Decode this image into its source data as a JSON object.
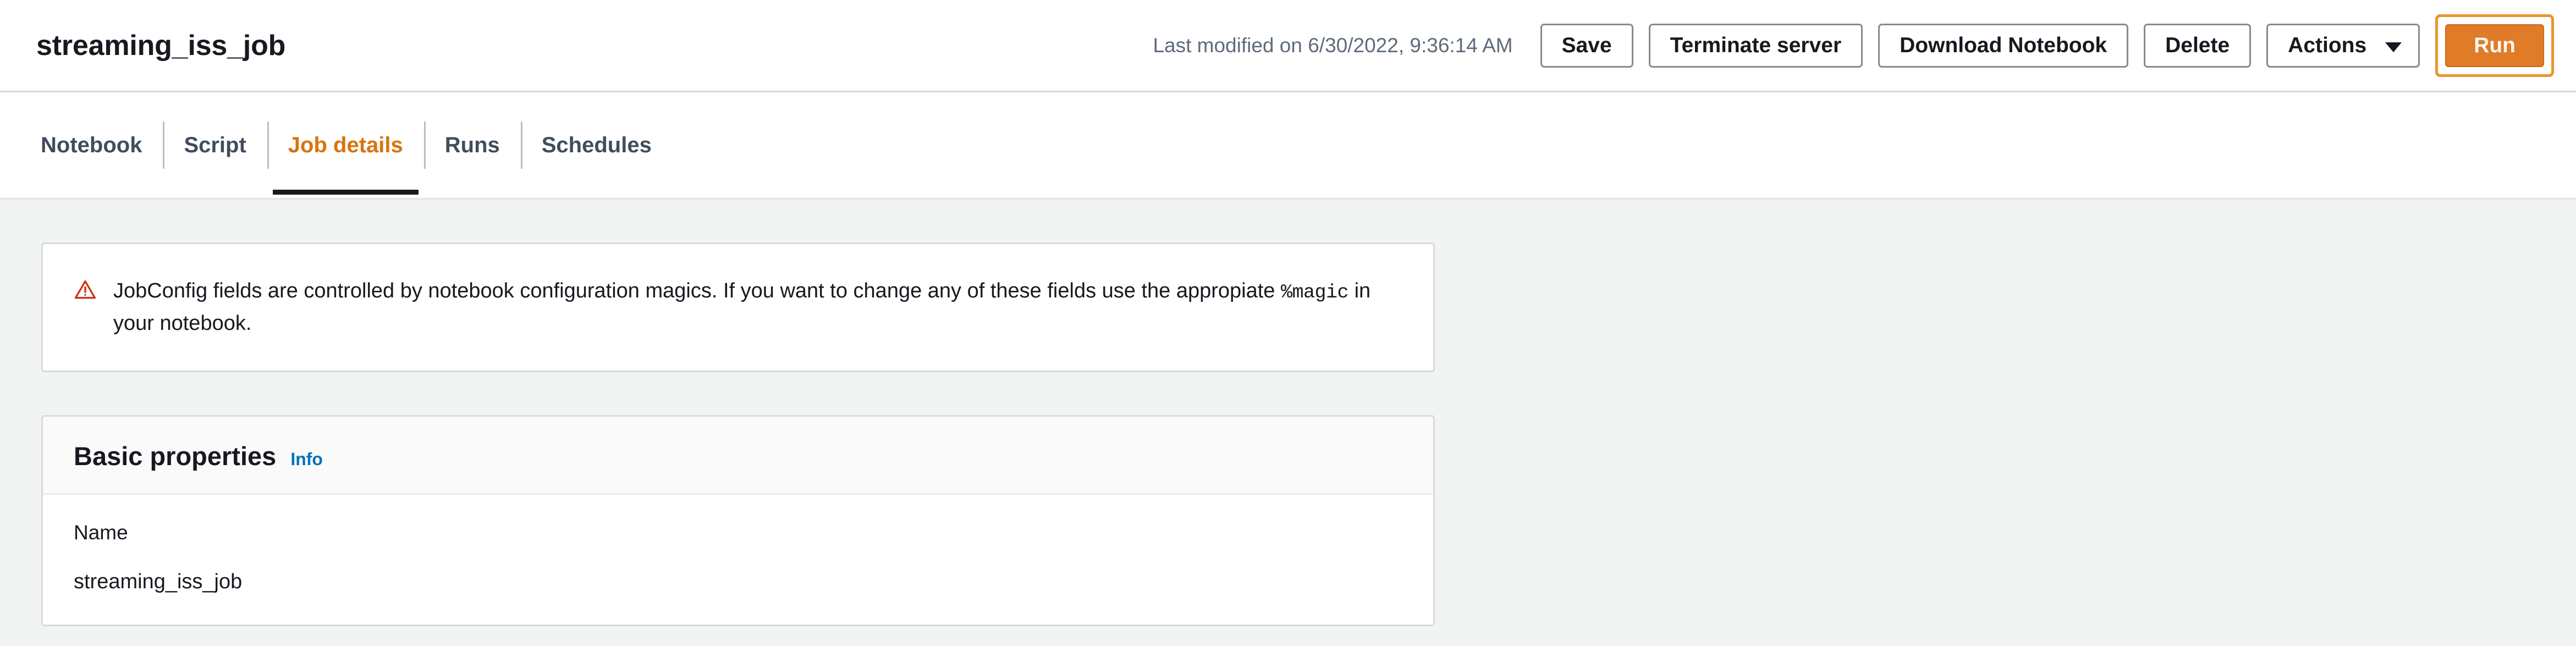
{
  "header": {
    "title": "streaming_iss_job",
    "last_modified": "Last modified on 6/30/2022, 9:36:14 AM",
    "buttons": {
      "save": "Save",
      "terminate_server": "Terminate server",
      "download_notebook": "Download Notebook",
      "delete": "Delete",
      "actions": "Actions",
      "run": "Run"
    }
  },
  "tabs": [
    {
      "label": "Notebook",
      "active": false
    },
    {
      "label": "Script",
      "active": false
    },
    {
      "label": "Job details",
      "active": true
    },
    {
      "label": "Runs",
      "active": false
    },
    {
      "label": "Schedules",
      "active": false
    }
  ],
  "alert": {
    "icon": "warning-triangle-icon",
    "text_before": "JobConfig fields are controlled by notebook configuration magics. If you want to change any of these fields use the appropiate ",
    "code": "%magic",
    "text_after": " in your notebook."
  },
  "basic_properties": {
    "title": "Basic properties",
    "info_link": "Info",
    "name_label": "Name",
    "name_value": "streaming_iss_job"
  },
  "colors": {
    "accent_orange": "#e07b28",
    "focus_ring_orange": "#e9962e",
    "active_tab_orange": "#d9730d",
    "link_blue": "#0073bb",
    "warning_red": "#d13212",
    "content_bg": "#f2f3f3",
    "border_gray": "#d5dbdb",
    "text_dark": "#16191f",
    "text_muted": "#5f6b7a"
  }
}
